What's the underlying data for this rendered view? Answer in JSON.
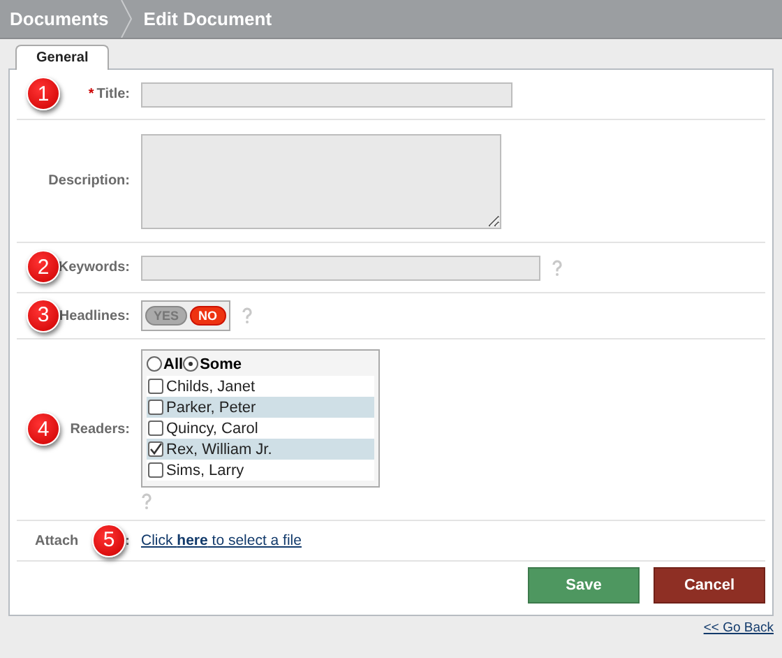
{
  "breadcrumb": [
    "Documents",
    "Edit Document"
  ],
  "tabs": [
    {
      "label": "General",
      "selected": true
    }
  ],
  "fields": [
    {
      "kind": "text",
      "label": "Title:",
      "required_mark": "*",
      "marker": "1",
      "help": false
    },
    {
      "kind": "textarea",
      "label": "Description:",
      "help": false
    },
    {
      "kind": "text",
      "label": "Keywords:",
      "marker": "2",
      "help": true
    },
    {
      "kind": "toggle",
      "label": "Headlines:",
      "marker": "3",
      "help": true,
      "yes": "YES",
      "no": "NO",
      "on": false
    },
    {
      "kind": "readers",
      "label": "Readers:",
      "marker": "4",
      "help": true,
      "options": [
        {
          "label": "All",
          "selected": false
        },
        {
          "label": "Some",
          "selected": true
        }
      ],
      "people": [
        {
          "name": "Childs, Janet",
          "checked": false
        },
        {
          "name": "Parker, Peter",
          "checked": false
        },
        {
          "name": "Quincy, Carol",
          "checked": false
        },
        {
          "name": "Rex, William Jr.",
          "checked": true
        },
        {
          "name": "Sims, Larry",
          "checked": false
        }
      ]
    },
    {
      "kind": "attach",
      "label": "Attach",
      "label_end": ":",
      "marker": "5",
      "help": false,
      "link": "Click **here** to select a file"
    }
  ],
  "buttons": [
    {
      "label": "Save",
      "kind": "primary"
    },
    {
      "label": "Cancel",
      "kind": "danger"
    }
  ],
  "back_link": "<< Go Back"
}
